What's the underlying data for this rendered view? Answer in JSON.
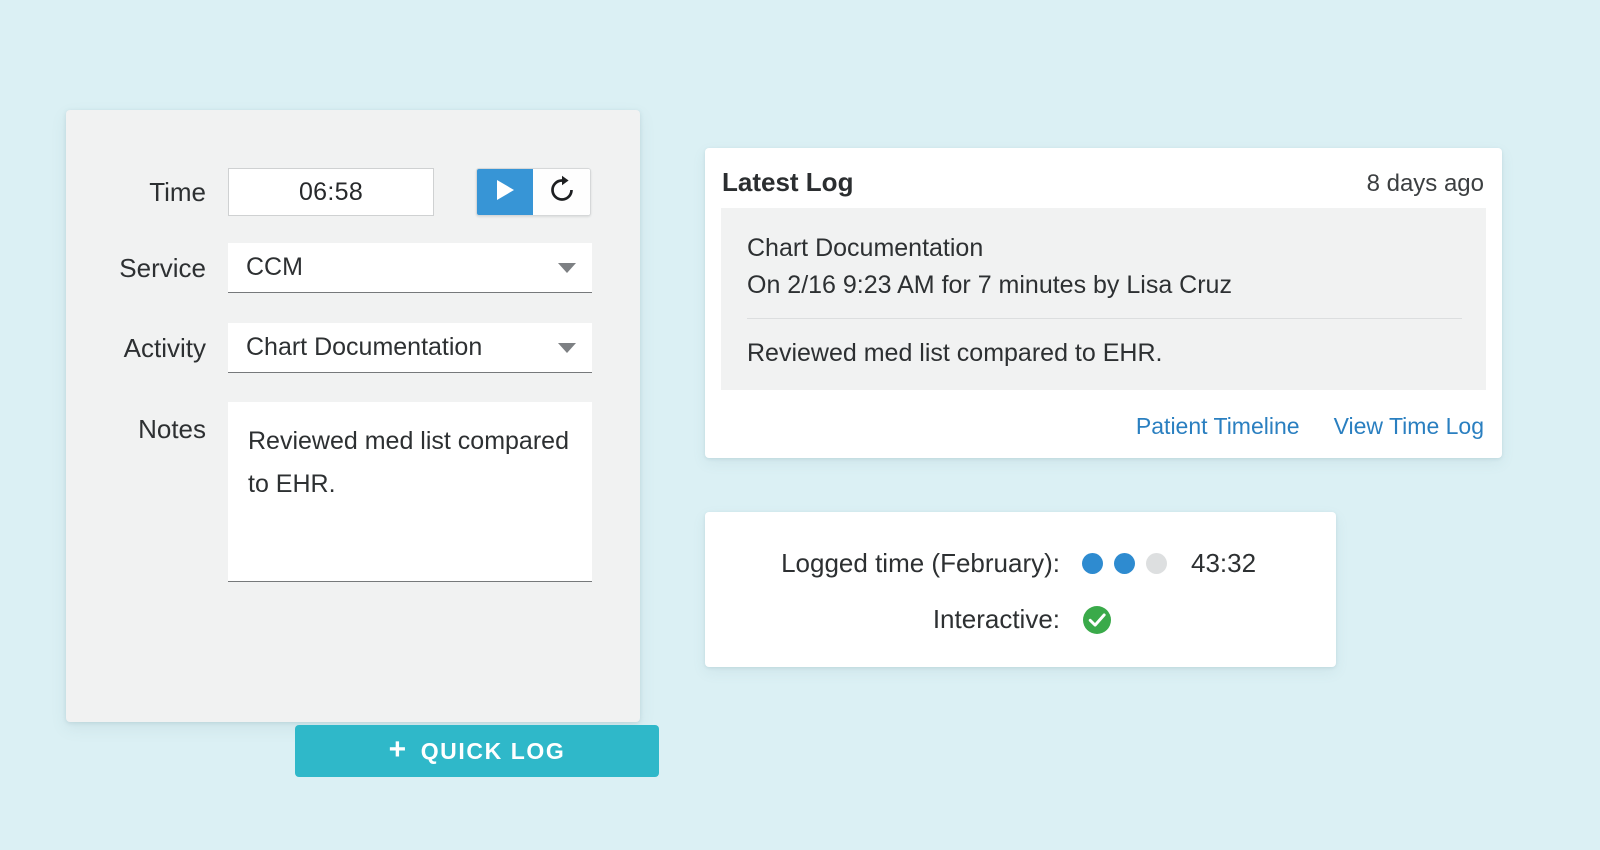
{
  "theme": {
    "page_background": "#dbf0f4",
    "card_background": "#f1f2f2",
    "panel_background": "#ffffff",
    "accent_teal": "#2fb8c9",
    "accent_blue": "#3795d6",
    "link_blue": "#2a7fc0",
    "dot_filled": "#2e8bd0",
    "dot_empty": "#dddfe0",
    "check_green": "#3aaa4a"
  },
  "timer_panel": {
    "time": {
      "label": "Time",
      "value": "06:58",
      "play_icon": "play-icon",
      "reset_icon": "refresh-icon"
    },
    "service": {
      "label": "Service",
      "value": "CCM",
      "chevron_icon": "chevron-down-icon"
    },
    "activity": {
      "label": "Activity",
      "value": "Chart Documentation",
      "chevron_icon": "chevron-down-icon"
    },
    "notes": {
      "label": "Notes",
      "value": "Reviewed med list compared to EHR."
    },
    "quick_log": {
      "plus": "+",
      "label": "QUICK LOG"
    }
  },
  "latest_log": {
    "title": "Latest Log",
    "age": "8 days ago",
    "entry": {
      "activity": "Chart Documentation",
      "meta": "On 2/16 9:23 AM for 7 minutes by Lisa Cruz",
      "note": "Reviewed med list compared to EHR."
    },
    "links": [
      {
        "label": "Patient Timeline"
      },
      {
        "label": "View Time Log"
      }
    ]
  },
  "summary": {
    "logged_time": {
      "label": "Logged time (February):",
      "dots": [
        "filled",
        "filled",
        "empty"
      ],
      "total": "43:32"
    },
    "interactive": {
      "label": "Interactive:",
      "status": "yes",
      "icon": "check-circle-icon"
    }
  }
}
